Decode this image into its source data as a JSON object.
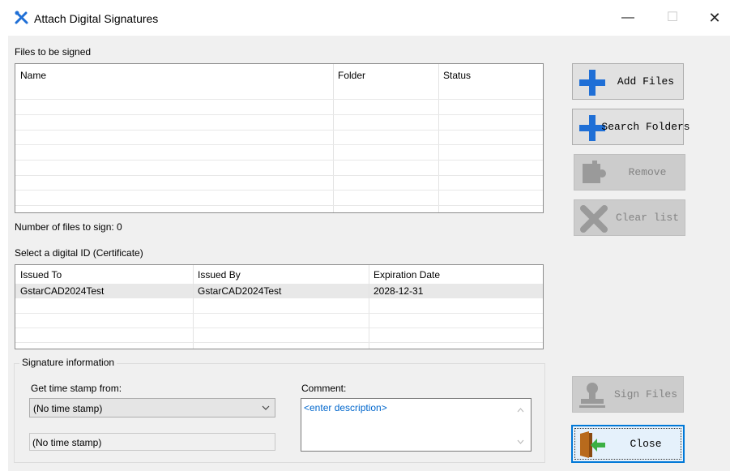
{
  "window": {
    "title": "Attach Digital Signatures",
    "minimize": "—",
    "maximize": "☐",
    "close": "✕"
  },
  "files_section": {
    "label": "Files to be signed",
    "columns": [
      "Name",
      "Folder",
      "Status"
    ],
    "rows": [],
    "count_text": "Number of files to sign: 0"
  },
  "cert_section": {
    "label": "Select a digital ID (Certificate)",
    "columns": [
      "Issued To",
      "Issued By",
      "Expiration Date"
    ],
    "rows": [
      {
        "issued_to": "GstarCAD2024Test",
        "issued_by": "GstarCAD2024Test",
        "expiration": "2028-12-31"
      }
    ]
  },
  "signature_info": {
    "group_title": "Signature information",
    "timestamp_label": "Get time stamp from:",
    "timestamp_selected": "(No time stamp)",
    "timestamp_display": "(No time stamp)",
    "comment_label": "Comment:",
    "comment_placeholder": "<enter description>"
  },
  "buttons": {
    "add_files": "Add Files",
    "search_folders": "Search Folders",
    "remove": "Remove",
    "clear_list": "Clear list",
    "sign_files": "Sign Files",
    "close": "Close"
  },
  "icons": {
    "app": "tools-icon",
    "add": "plus-icon",
    "remove": "puzzle-icon",
    "clear": "x-icon",
    "sign": "stamp-icon",
    "close": "exit-door-icon"
  },
  "colors": {
    "accent": "#0078d7",
    "plus_blue": "#1f6fd6",
    "link_blue": "#0066cc",
    "disabled_icon": "#9a9a9a"
  }
}
